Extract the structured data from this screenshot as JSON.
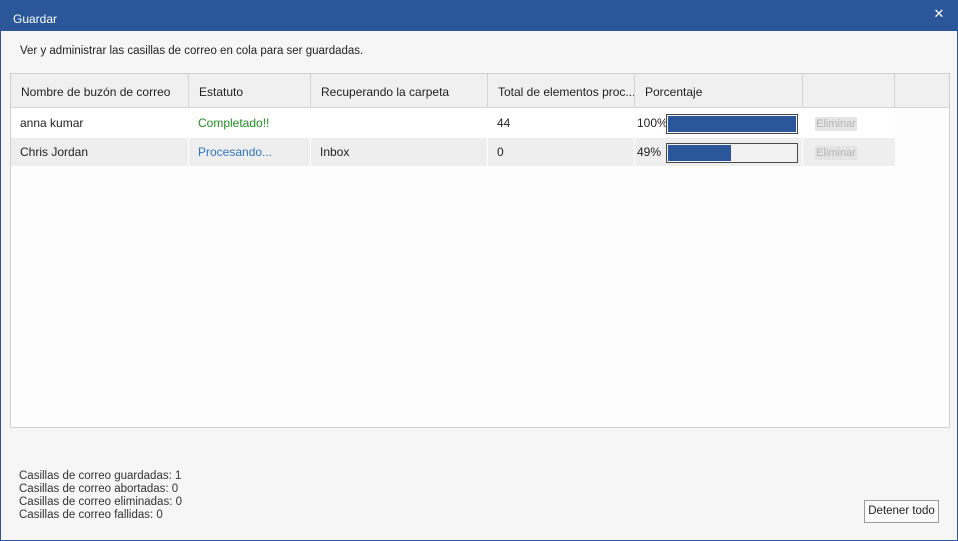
{
  "window": {
    "title": "Guardar",
    "close_label": "✕"
  },
  "description": "Ver y administrar las casillas de correo en cola para ser guardadas.",
  "table": {
    "columns": [
      "Nombre de buzón de correo",
      "Estatuto",
      "Recuperando la carpeta",
      "Total de elementos proc...",
      "Porcentaje",
      "",
      ""
    ],
    "rows": [
      {
        "mailbox": "anna kumar",
        "status": "Completado!!",
        "folder": "",
        "total": "44",
        "percent_text": "100%",
        "percent_value": 100,
        "action": "Eliminar"
      },
      {
        "mailbox": "Chris Jordan",
        "status": "Procesando...",
        "folder": "Inbox",
        "total": "0",
        "percent_text": "49%",
        "percent_value": 49,
        "action": "Eliminar"
      }
    ]
  },
  "summary": {
    "saved": "Casillas de correo guardadas: 1",
    "aborted": "Casillas de correo abortadas: 0",
    "deleted": "Casillas de correo eliminadas: 0",
    "failed": "Casillas de correo fallidas: 0"
  },
  "buttons": {
    "stop_all": "Detener todo"
  },
  "colors": {
    "accent": "#2b579a",
    "status_done": "#1f8f1f",
    "status_processing": "#2e75c4"
  }
}
